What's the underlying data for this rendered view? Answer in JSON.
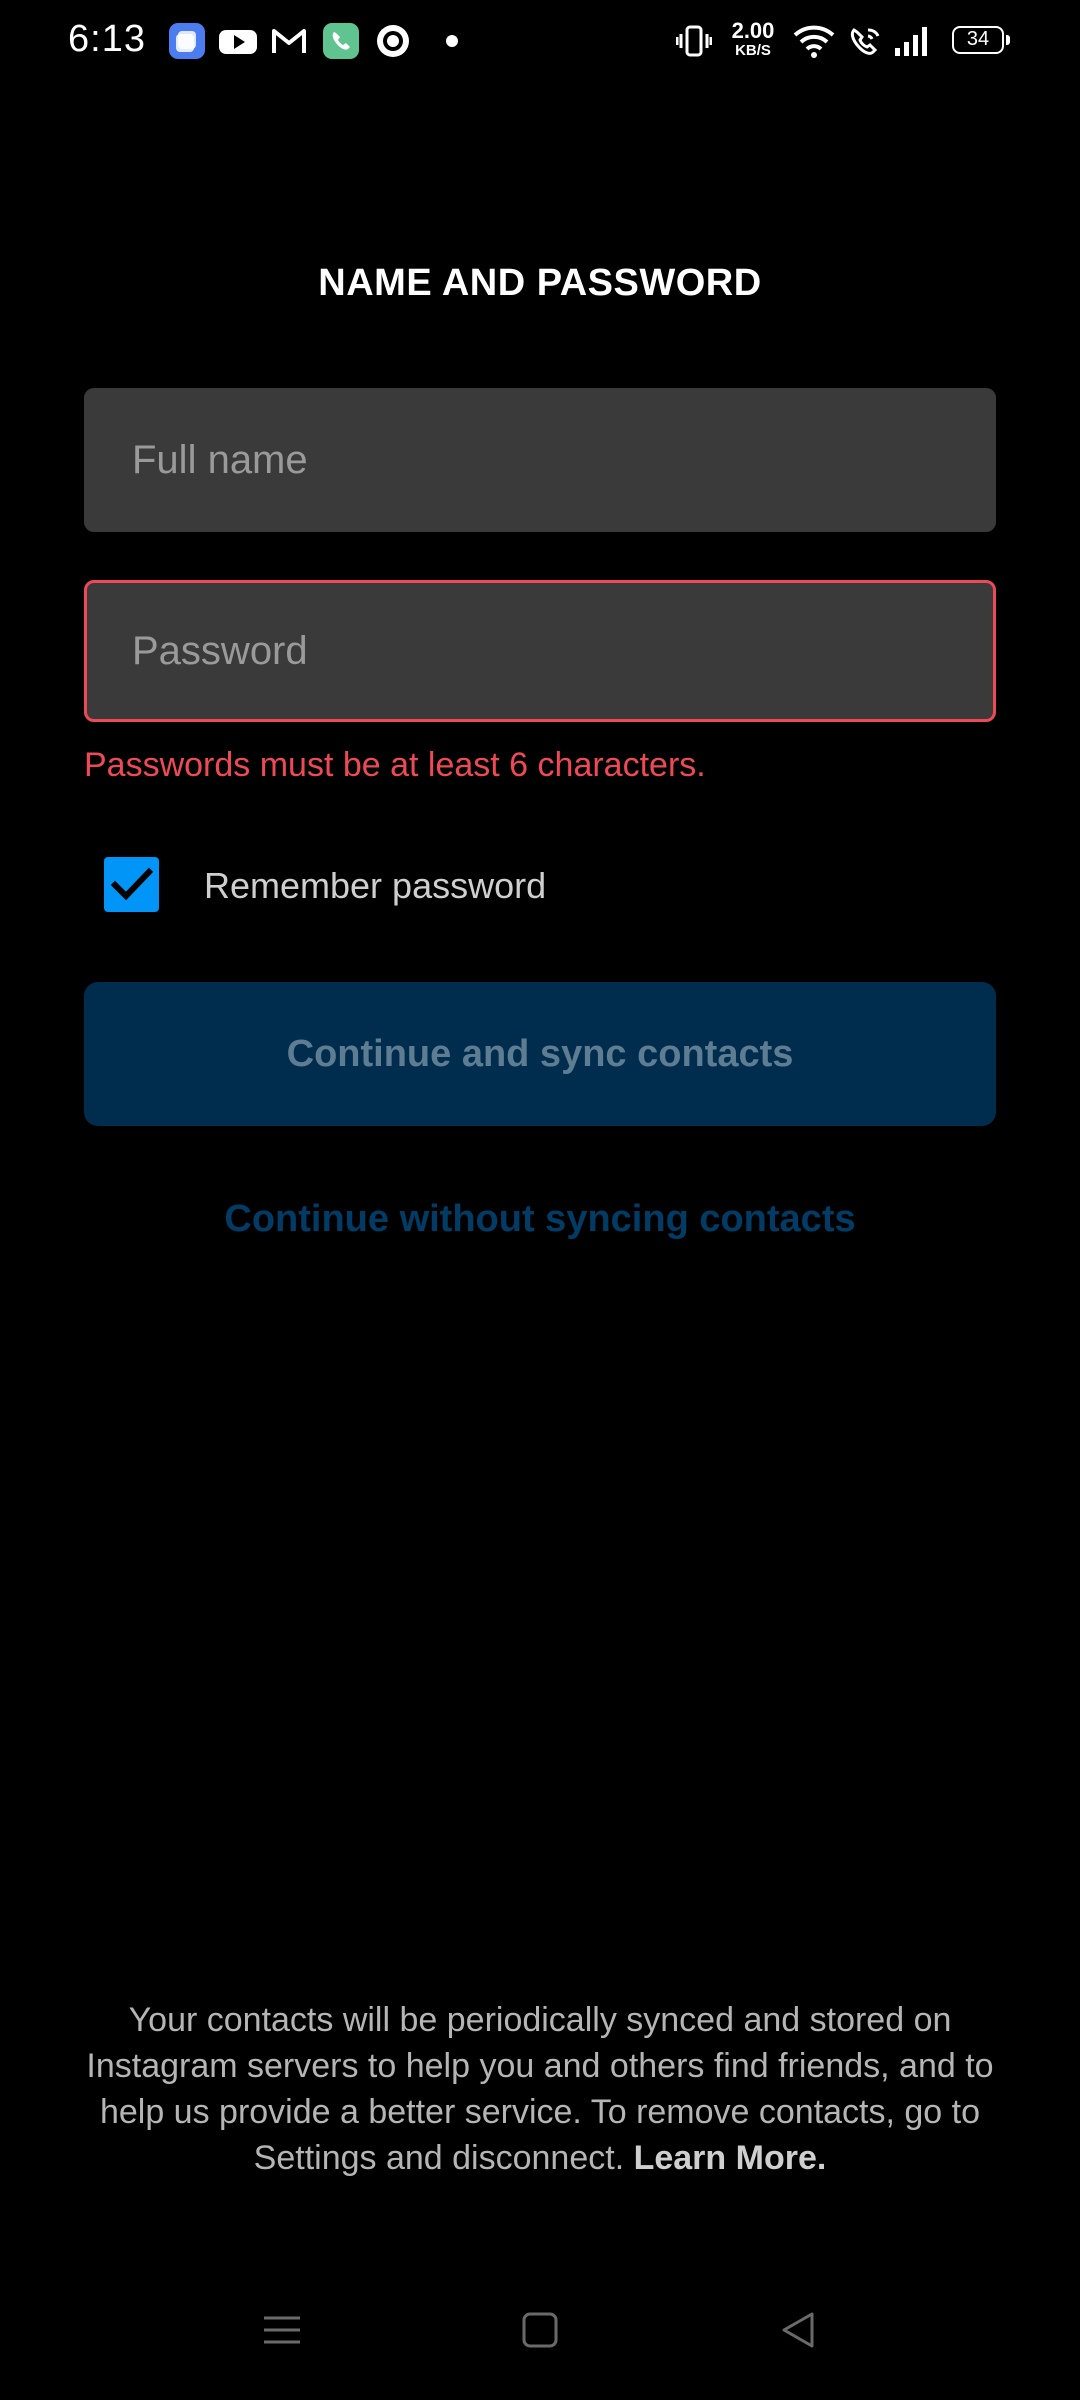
{
  "status_bar": {
    "time": "6:13",
    "network_speed_value": "2.00",
    "network_speed_unit": "KB/S",
    "battery_level": "34",
    "notification_icons": [
      "photos-app-icon",
      "youtube-icon",
      "gmail-icon",
      "phone-icon",
      "circle-app-icon"
    ],
    "system_icons": [
      "vibrate-icon",
      "wifi-icon",
      "wifi-calling-icon",
      "signal-icon",
      "battery-icon"
    ]
  },
  "form": {
    "title": "NAME AND PASSWORD",
    "full_name_placeholder": "Full name",
    "full_name_value": "",
    "password_placeholder": "Password",
    "password_value": "",
    "password_error": "Passwords must be at least 6 characters.",
    "remember_label": "Remember password",
    "remember_checked": true
  },
  "actions": {
    "primary": "Continue and sync contacts",
    "secondary": "Continue without syncing contacts"
  },
  "footer": {
    "text": "Your contacts will be periodically synced and stored on Instagram servers to help you and others find friends, and to help us provide a better service. To remove contacts, go to Settings and disconnect. ",
    "learn_more": "Learn More."
  },
  "nav_bar": {
    "items": [
      "menu-icon",
      "home-icon",
      "back-icon"
    ]
  },
  "colors": {
    "background": "#000000",
    "input_bg": "#3a3a3a",
    "error": "#ed4956",
    "checkbox": "#0095f6",
    "primary_button_bg": "#002d4e",
    "primary_button_text": "#5e7d92",
    "link_text": "#003c66"
  }
}
